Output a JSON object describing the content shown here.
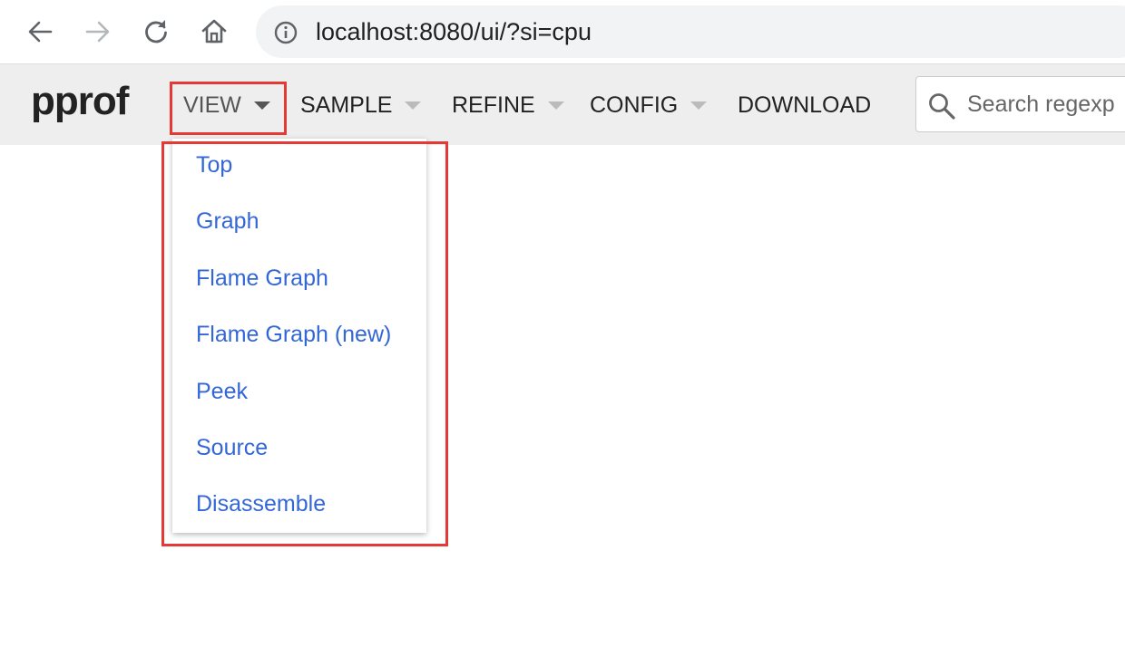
{
  "browser": {
    "url": "localhost:8080/ui/?si=cpu",
    "icons": {
      "back": "arrow-left-icon",
      "forward": "arrow-right-icon",
      "reload": "reload-icon",
      "home": "home-icon",
      "info": "info-icon"
    }
  },
  "header": {
    "logo": "pprof",
    "menu": [
      {
        "label": "VIEW",
        "has_dropdown": true,
        "open": true
      },
      {
        "label": "SAMPLE",
        "has_dropdown": true
      },
      {
        "label": "REFINE",
        "has_dropdown": true
      },
      {
        "label": "CONFIG",
        "has_dropdown": true
      },
      {
        "label": "DOWNLOAD",
        "has_dropdown": false
      }
    ],
    "search": {
      "placeholder": "Search regexp",
      "icon": "search-icon"
    }
  },
  "view_dropdown": {
    "items": [
      "Top",
      "Graph",
      "Flame Graph",
      "Flame Graph (new)",
      "Peek",
      "Source",
      "Disassemble"
    ]
  },
  "colors": {
    "link": "#3367d6",
    "highlight": "#e53935",
    "header_bg": "#eeeeee"
  }
}
